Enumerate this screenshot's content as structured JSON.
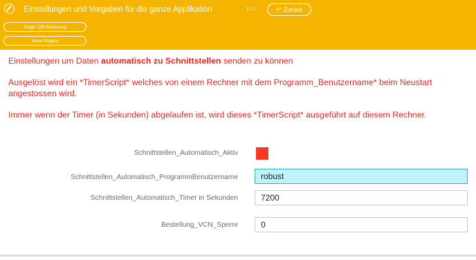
{
  "header": {
    "title": "Einstellungen und Vorgaben für die ganze Applikation",
    "pager": "1 / 1",
    "back_label": "Zurück",
    "buttons": [
      "Plugin QR-Rechnung",
      "More Plugins"
    ]
  },
  "content": {
    "intro_before": "Einstellungen um Daten ",
    "intro_bold": "automatisch zu Schnittstellen",
    "intro_after": " senden zu können",
    "trigger_text": "Ausgelöst wird ein *TimerScript* welches von einem Rechner mit dem Programm_Benutzername* beim Neustart angestossen wird.",
    "timer_text": "Immer wenn der Timer (in Sekunden) abgelaufen ist, wird dieses *TimerScript* ausgeführt auf diesem Rechner."
  },
  "form": {
    "active_label": "Schnittstellen_Automatisch_Aktiv",
    "active_checked": true,
    "username_label": "Schnittstellen_Automatisch_ProgrammBenutzername",
    "username_value": "robust",
    "timer_label": "Schnittstellen_Automatisch_Timer in Sekunden",
    "timer_value": "7200",
    "vcn_label": "Bestellung_VCN_Sperre",
    "vcn_value": "0"
  },
  "colors": {
    "header_bg": "#f5b400",
    "text_red": "#e8231c",
    "checkbox_red": "#f23a25",
    "focus_bg": "#bff3fb"
  }
}
